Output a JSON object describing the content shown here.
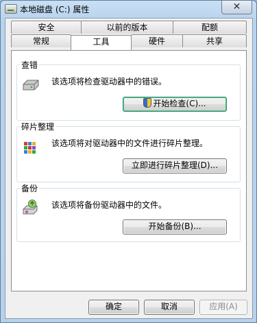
{
  "window": {
    "title": "本地磁盘 (C:) 属性",
    "close_glyph": "✕"
  },
  "tabs": {
    "row1": [
      "安全",
      "以前的版本",
      "配额"
    ],
    "row2": [
      "常规",
      "工具",
      "硬件",
      "共享"
    ],
    "active": "工具"
  },
  "groups": {
    "check": {
      "title": "查错",
      "description": "该选项将检查驱动器中的错误。",
      "button": "开始检查(C)...",
      "icon": "drive-check-icon"
    },
    "defrag": {
      "title": "碎片整理",
      "description": "该选项将对驱动器中的文件进行碎片整理。",
      "button": "立即进行碎片整理(D)...",
      "icon": "defrag-icon"
    },
    "backup": {
      "title": "备份",
      "description": "该选项将备份驱动器中的文件。",
      "button": "开始备份(B)...",
      "icon": "backup-icon"
    }
  },
  "footer": {
    "ok": "确定",
    "cancel": "取消",
    "apply": "应用(A)"
  },
  "colors": {
    "focus_green": "#48d148",
    "shield_blue": "#2f6fd0",
    "shield_yellow": "#f2c230"
  }
}
